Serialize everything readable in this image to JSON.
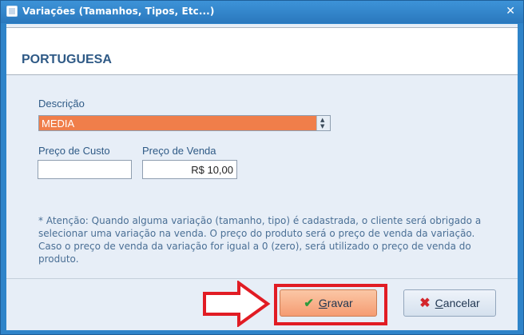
{
  "window": {
    "title": "Variações (Tamanhos, Tipos, Etc...)",
    "close_glyph": "✕"
  },
  "header": {
    "title": "PORTUGUESA"
  },
  "form": {
    "descricao_label": "Descrição",
    "descricao_value": "MEDIA",
    "preco_custo_label": "Preço de Custo",
    "preco_custo_value": "",
    "preco_venda_label": "Preço de Venda",
    "preco_venda_value": "R$ 10,00"
  },
  "note": {
    "line1": "* Atenção: Quando alguma variação (tamanho, tipo) é cadastrada, o cliente será obrigado a",
    "line2": "selecionar uma variação na venda. O preço do produto será o preço de venda da variação.",
    "line3": "Caso o preço de venda da variação for igual a 0 (zero), será utilizado o preço de venda do produto."
  },
  "buttons": {
    "save_label": "Gravar",
    "cancel_label": "Cancelar"
  },
  "colors": {
    "titlebar": "#2f84c9",
    "selected_combo": "#f07e4a",
    "highlight": "#e11c24"
  }
}
